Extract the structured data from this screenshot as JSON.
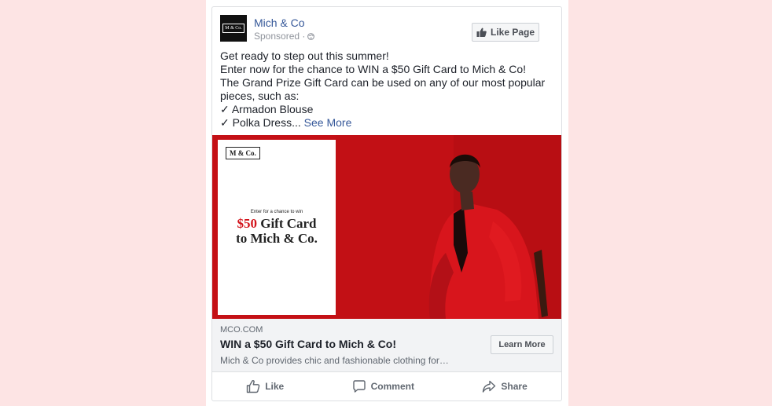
{
  "post": {
    "page_name": "Mich & Co",
    "sponsored": "Sponsored ·",
    "logo_text": "M & Co.",
    "like_page_label": "Like Page",
    "text_lines": [
      "Get ready to step out this summer!",
      "Enter now for the chance to WIN a $50 Gift Card to Mich & Co!",
      "The Grand Prize Gift Card can be used on any of our most popular pieces, such as:",
      "✓ Armadon Blouse",
      "✓ Polka Dress..."
    ],
    "see_more": "See More"
  },
  "ad_image": {
    "logo_text": "M & Co.",
    "small_text": "Enter for a chance to win",
    "price": "$50",
    "big_line1_rest": " Gift Card",
    "big_line2": "to Mich & Co."
  },
  "link": {
    "domain": "MCO.COM",
    "headline": "WIN a $50 Gift Card to Mich & Co!",
    "description": "Mich & Co provides chic and fashionable clothing for…",
    "cta_label": "Learn More"
  },
  "actions": {
    "like": "Like",
    "comment": "Comment",
    "share": "Share"
  },
  "colors": {
    "background": "#fde4e4",
    "link_blue": "#365899",
    "ad_red": "#c41016"
  }
}
